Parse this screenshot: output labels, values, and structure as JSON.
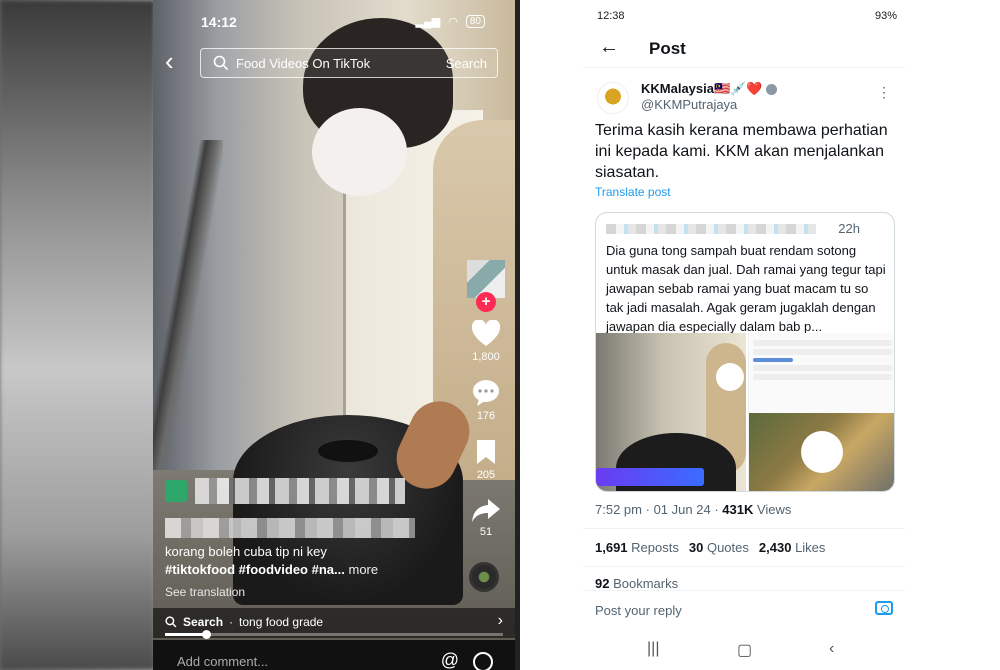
{
  "tiktok": {
    "status": {
      "time": "14:12",
      "battery": "80"
    },
    "search": {
      "query": "Food Videos On TikTok",
      "button": "Search"
    },
    "actions": [
      {
        "icon": "heart-icon",
        "count": "1,800"
      },
      {
        "icon": "comment-icon",
        "count": "176"
      },
      {
        "icon": "bookmark-icon",
        "count": "205"
      },
      {
        "icon": "share-icon",
        "count": "51"
      }
    ],
    "caption": {
      "description": "korang boleh cuba tip ni key",
      "hashtags": "#tiktokfood #foodvideo #na...",
      "more": "more",
      "see_translation": "See translation"
    },
    "bottom_search": {
      "label": "Search",
      "separator": "·",
      "term": "tong food grade"
    },
    "progress": 0.12,
    "comment": {
      "placeholder": "Add comment...",
      "at": "@"
    }
  },
  "x": {
    "status": {
      "time": "12:38",
      "battery": "93%"
    },
    "header": {
      "title": "Post"
    },
    "author": {
      "name": "KKMalaysia",
      "flags": "🇲🇾💉❤️",
      "handle": "@KKMPutrajaya"
    },
    "text": "Terima kasih kerana membawa perhatian ini kepada kami. KKM akan menjalankan siasatan.",
    "translate": "Translate post",
    "quote": {
      "time": "22h",
      "text": "Dia guna tong sampah buat rendam sotong untuk masak dan jual. Dah ramai yang tegur tapi jawapan sebab ramai yang buat macam tu so tak jadi masalah. Agak geram jugaklah dengan jawapan dia especially dalam bab p..."
    },
    "meta": {
      "time": "7:52 pm",
      "sep": "·",
      "date": "01 Jun 24",
      "views": "431K",
      "views_label": "Views"
    },
    "stats": {
      "reposts": "1,691",
      "reposts_label": "Reposts",
      "quotes": "30",
      "quotes_label": "Quotes",
      "likes": "2,430",
      "likes_label": "Likes",
      "bookmarks": "92",
      "bookmarks_label": "Bookmarks"
    },
    "reply_placeholder": "Post your reply"
  }
}
